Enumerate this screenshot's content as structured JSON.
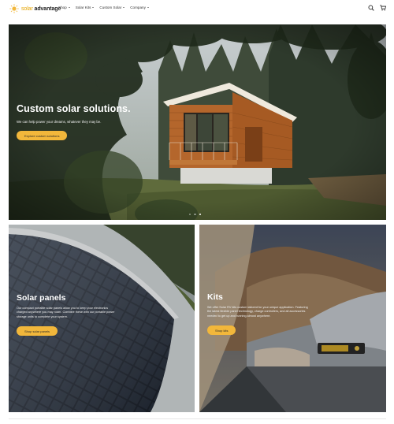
{
  "brand": {
    "name_accent": "solar",
    "name_main": " advantage",
    "accent_color": "#e5a400"
  },
  "nav": {
    "items": [
      {
        "label": "Shop"
      },
      {
        "label": "Solar Kits"
      },
      {
        "label": "Custom Solar"
      },
      {
        "label": "Company"
      }
    ]
  },
  "header_icons": {
    "search": "search-icon",
    "cart": "cart-icon"
  },
  "hero": {
    "title": "Custom solar solutions.",
    "subtitle": "We can help power your dreams, whatever they may be.",
    "button_label": "Explore custom solutions",
    "slides": 3,
    "active_slide": 3
  },
  "cards": {
    "solar_panels": {
      "title": "Solar panels",
      "text": "Our compact portable solar panels allow you to keep your electronics charged anywhere you may roam. Combine these with our portable power storage units to complete your system.",
      "button_label": "Shop solar panels"
    },
    "kits": {
      "title": "Kits",
      "text": "We offer Solar RV kits custom tailored for your unique application. Featuring the latest flexible panel technology, charge controllers, and all accessories needed to get up and running almost anywhere.",
      "button_label": "Shop kits"
    }
  },
  "colors": {
    "button": "#f2b73b"
  }
}
